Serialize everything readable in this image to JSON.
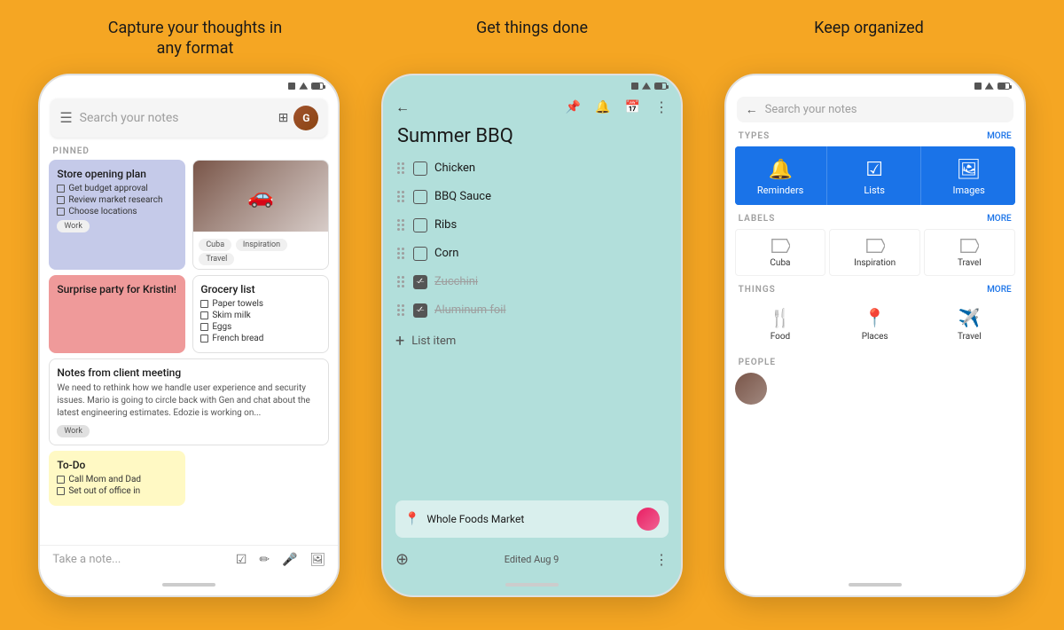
{
  "page": {
    "background_color": "#F5A623"
  },
  "headers": {
    "left": "Capture your thoughts in\nany format",
    "center": "Get things done",
    "right": "Keep organized"
  },
  "phone1": {
    "search_placeholder": "Search your notes",
    "pinned_label": "PINNED",
    "note1": {
      "title": "Store opening plan",
      "items": [
        "Get budget approval",
        "Review market research",
        "Choose locations"
      ],
      "tag": "Work"
    },
    "note2": {
      "tags": [
        "Cuba",
        "Inspiration",
        "Travel"
      ]
    },
    "note3": {
      "title": "Surprise party for Kristin!"
    },
    "note4": {
      "title": "Grocery list",
      "items": [
        "Paper towels",
        "Skim milk",
        "Eggs",
        "French bread"
      ]
    },
    "note5": {
      "title": "Notes from client meeting",
      "body": "We need to rethink how we handle user experience and security issues. Mario is going to circle back with Gen and chat about the latest engineering estimates. Edozie is working on...",
      "tag": "Work"
    },
    "note6": {
      "title": "To-Do",
      "items": [
        "Call Mom and Dad",
        "Set out of office in"
      ]
    },
    "take_note_placeholder": "Take a note..."
  },
  "phone2": {
    "note_title": "Summer BBQ",
    "checklist": [
      {
        "text": "Chicken",
        "done": false
      },
      {
        "text": "BBQ Sauce",
        "done": false
      },
      {
        "text": "Ribs",
        "done": false
      },
      {
        "text": "Corn",
        "done": false
      },
      {
        "text": "Zucchini",
        "done": true
      },
      {
        "text": "Aluminum foil",
        "done": true
      }
    ],
    "add_item_label": "List item",
    "location": "Whole Foods Market",
    "edited_text": "Edited Aug 9"
  },
  "phone3": {
    "search_placeholder": "Search your notes",
    "types_label": "TYPES",
    "more_label": "MORE",
    "types": [
      {
        "icon": "🔔",
        "label": "Reminders"
      },
      {
        "icon": "✅",
        "label": "Lists"
      },
      {
        "icon": "🖼️",
        "label": "Images"
      }
    ],
    "labels_label": "LABELS",
    "labels": [
      {
        "icon": "🏷",
        "label": "Cuba"
      },
      {
        "icon": "🏷",
        "label": "Inspiration"
      },
      {
        "icon": "🏷",
        "label": "Travel"
      }
    ],
    "things_label": "THINGS",
    "things": [
      {
        "icon": "🍴",
        "label": "Food"
      },
      {
        "icon": "📍",
        "label": "Places"
      },
      {
        "icon": "✈️",
        "label": "Travel"
      }
    ],
    "people_label": "PEOPLE"
  }
}
